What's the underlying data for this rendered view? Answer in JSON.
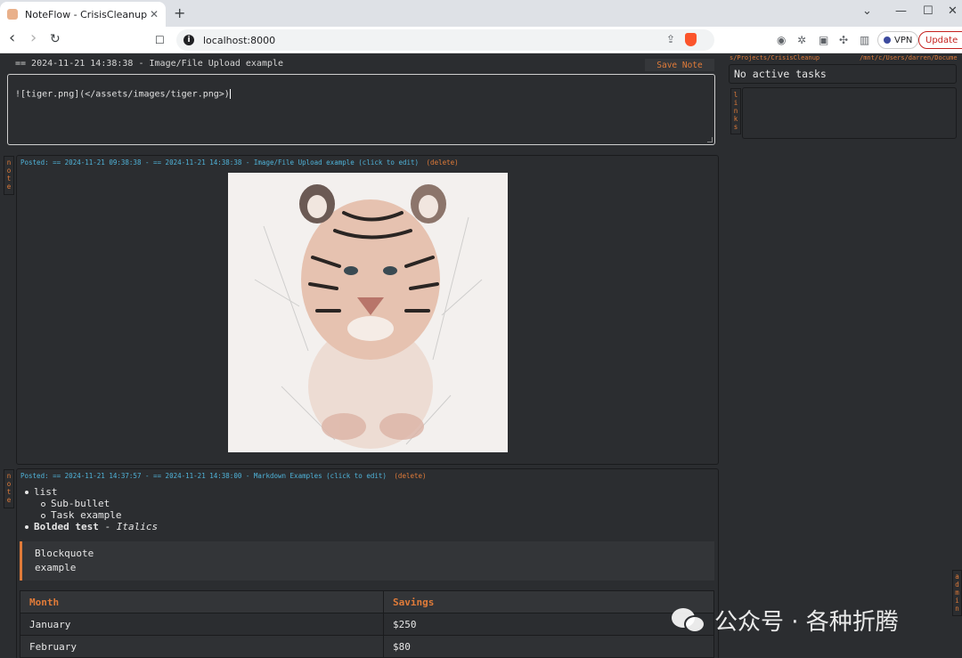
{
  "browser": {
    "tab_title": "NoteFlow - CrisisCleanup",
    "tab_close": "✕",
    "new_tab": "+",
    "url": "localhost:8000",
    "vpn_label": "VPN",
    "update_label": "Update",
    "controls": {
      "dropdown": "⌄",
      "minimize": "—",
      "maximize": "☐",
      "close": "✕"
    },
    "nav": {
      "back": "‹",
      "forward": "›",
      "reload": "↻",
      "bookmark": "☐"
    }
  },
  "editor": {
    "header": "== 2024-11-21 14:38:38 - Image/File Upload example",
    "save_label": "Save Note",
    "content": "![tiger.png](</assets/images/tiger.png>)"
  },
  "sidebar": {
    "path_left": "s/Projects/CrisisCleanup",
    "path_right": "/mnt/c/Users/darren/Docume",
    "tasks_text": "No active tasks",
    "links_tab": [
      "l",
      "i",
      "n",
      "k",
      "s"
    ],
    "admin_tab": [
      "a",
      "d",
      "m",
      "i",
      "n"
    ]
  },
  "notes": [
    {
      "tab": [
        "n",
        "o",
        "t",
        "e"
      ],
      "posted_label": "Posted:",
      "posted_text": "== 2024-11-21 09:38:38 - == 2024-11-21 14:38:38 - Image/File Upload example (click to edit)",
      "delete_label": "(delete)"
    },
    {
      "tab": [
        "n",
        "o",
        "t",
        "e"
      ],
      "posted_label": "Posted:",
      "posted_text": "== 2024-11-21 14:37:57 - == 2024-11-21 14:38:00 - Markdown Examples (click to edit)",
      "delete_label": "(delete)",
      "list": {
        "item1": "list",
        "sub1": "Sub-bullet",
        "sub2": "Task example",
        "bold": "Bolded test",
        "sep": " - ",
        "italic": "Italics"
      },
      "quote": [
        "Blockquote",
        "example"
      ],
      "table": {
        "headers": [
          "Month",
          "Savings"
        ],
        "rows": [
          [
            "January",
            "$250"
          ],
          [
            "February",
            "$80"
          ]
        ]
      }
    }
  ],
  "watermark": "公众号 · 各种折腾"
}
